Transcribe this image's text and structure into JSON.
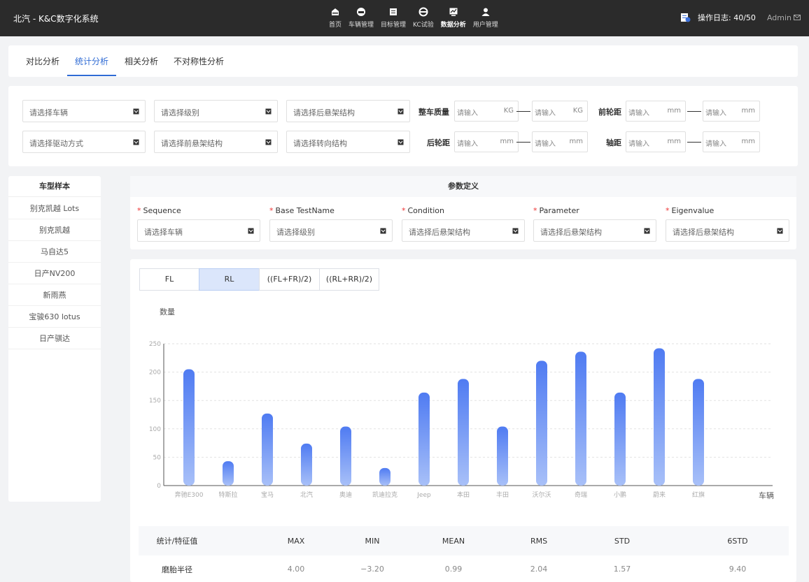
{
  "header": {
    "app_title": "北汽 - K&C数字化系统",
    "nav": [
      {
        "label": "首页",
        "icon": "home-icon"
      },
      {
        "label": "车辆管理",
        "icon": "car-icon"
      },
      {
        "label": "目标管理",
        "icon": "target-icon"
      },
      {
        "label": "KC试验",
        "icon": "steering-wheel-icon"
      },
      {
        "label": "数据分析",
        "icon": "chart-icon"
      },
      {
        "label": "用户管理",
        "icon": "user-icon"
      }
    ],
    "active_nav": 4,
    "log_label": "操作日志: 40/50",
    "admin_label": "Admin"
  },
  "tabs": [
    {
      "label": "对比分析"
    },
    {
      "label": "统计分析"
    },
    {
      "label": "相关分析"
    },
    {
      "label": "不对称性分析"
    }
  ],
  "active_tab": 1,
  "filters": {
    "select_vehicle": "请选择车辆",
    "select_level": "请选择级别",
    "select_rear_susp": "请选择后悬架结构",
    "select_drive": "请选择驱动方式",
    "select_front_susp": "请选择前悬架结构",
    "select_steering": "请选择转向结构",
    "mass_label": "整车质量",
    "front_track_label": "前轮距",
    "rear_track_label": "后轮距",
    "wheelbase_label": "轴距",
    "input_placeholder": "请输入",
    "unit_kg": "KG",
    "unit_mm": "mm"
  },
  "sidebar": {
    "title": "车型样本",
    "items": [
      "别克凯越 Lots",
      "别克凯越",
      "马自达5",
      "日产NV200",
      "新雨燕",
      "宝骏630 lotus",
      "日产骐达"
    ]
  },
  "params": {
    "title": "参数定义",
    "fields": [
      {
        "label": "Sequence",
        "placeholder": "请选择车辆"
      },
      {
        "label": "Base TestName",
        "placeholder": "请选择级别"
      },
      {
        "label": "Condition",
        "placeholder": "请选择后悬架结构"
      },
      {
        "label": "Parameter",
        "placeholder": "请选择后悬架结构"
      },
      {
        "label": "Eigenvalue",
        "placeholder": "请选择后悬架结构"
      }
    ]
  },
  "chart_buttons": [
    "FL",
    "RL",
    "((FL+FR)/2)",
    "((RL+RR)/2)"
  ],
  "active_chart_button": 1,
  "chart_data": {
    "type": "bar",
    "ylabel": "数量",
    "xlabel": "车辆",
    "ylim": [
      0,
      250
    ],
    "yticks": [
      0,
      50,
      100,
      150,
      200,
      250
    ],
    "grid": true,
    "categories": [
      "奔驰E300",
      "特斯拉",
      "宝马",
      "北汽",
      "奥迪",
      "凯迪拉克",
      "Jeep",
      "本田",
      "丰田",
      "沃尔沃",
      "奇瑞",
      "小鹏",
      "蔚来",
      "红旗"
    ],
    "values": [
      205,
      43,
      127,
      74,
      104,
      31,
      164,
      188,
      104,
      220,
      236,
      164,
      242,
      188
    ],
    "colors": {
      "bar_top": "#4f7bf2",
      "bar_bottom": "#a8c0f8"
    }
  },
  "stats": {
    "headers": [
      "统计/特征值",
      "MAX",
      "MIN",
      "MEAN",
      "RMS",
      "STD",
      "6STD"
    ],
    "rows": [
      [
        "磨胎半径",
        "4.00",
        "−3.20",
        "0.99",
        "2.04",
        "1.57",
        "9.40"
      ]
    ]
  }
}
